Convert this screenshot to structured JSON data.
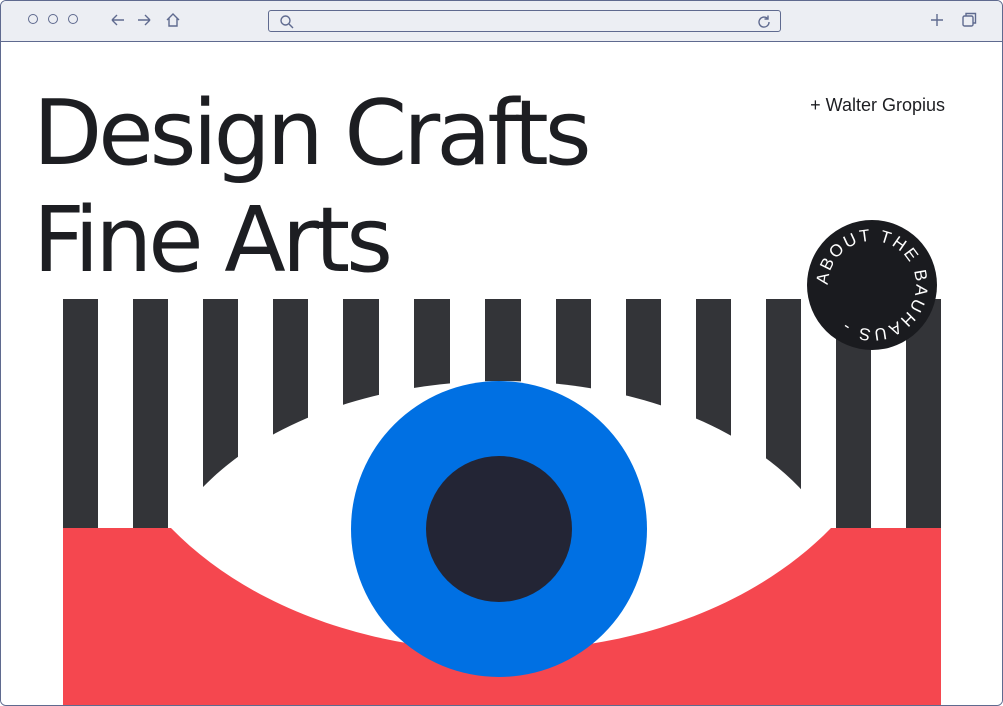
{
  "browser": {
    "address_value": "",
    "icons": [
      "circle-icon",
      "circle-icon",
      "circle-icon",
      "arrow-left-icon",
      "arrow-right-icon",
      "home-icon",
      "search-icon",
      "reload-icon",
      "plus-icon",
      "tabs-icon"
    ]
  },
  "hero": {
    "title_line1": "Design Crafts",
    "title_line2": "Fine Arts",
    "credit": "+ Walter Gropius"
  },
  "badge": {
    "text": "ABOUT THE BAUHAUS - "
  },
  "colors": {
    "stripe": "#333438",
    "iris": "#0070e3",
    "pupil": "#232535",
    "red": "#f5474f",
    "badge": "#1a1b1f",
    "text": "#1d1e22"
  }
}
